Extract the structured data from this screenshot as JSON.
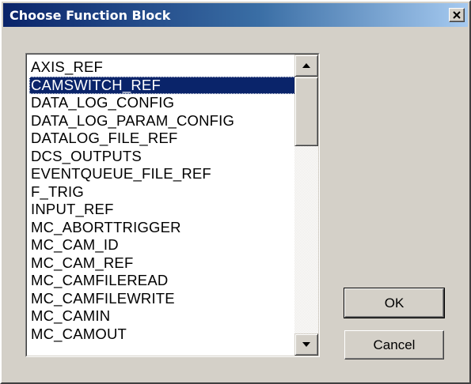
{
  "dialog": {
    "title": "Choose Function Block",
    "close_icon": "close-x-icon"
  },
  "function_blocks": {
    "selected_index": 1,
    "items": [
      "AXIS_REF",
      "CAMSWITCH_REF",
      "DATA_LOG_CONFIG",
      "DATA_LOG_PARAM_CONFIG",
      "DATALOG_FILE_REF",
      "DCS_OUTPUTS",
      "EVENTQUEUE_FILE_REF",
      "F_TRIG",
      "INPUT_REF",
      "MC_ABORTTRIGGER",
      "MC_CAM_ID",
      "MC_CAM_REF",
      "MC_CAMFILEREAD",
      "MC_CAMFILEWRITE",
      "MC_CAMIN",
      "MC_CAMOUT"
    ]
  },
  "scrollbar": {
    "up_icon": "arrow-up-icon",
    "down_icon": "arrow-down-icon"
  },
  "buttons": {
    "ok_label": "OK",
    "cancel_label": "Cancel"
  },
  "colors": {
    "selection_bg": "#0a246a",
    "title_gradient_start": "#0a246a",
    "title_gradient_end": "#a6caf0",
    "face": "#d4d0c8"
  }
}
